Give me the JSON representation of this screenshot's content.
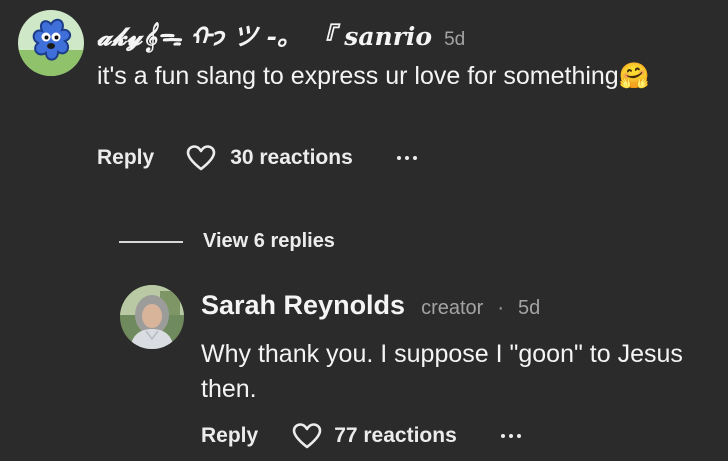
{
  "comment": {
    "username": "𝓪𝓴𝔂𝄞ᯓ ᡣ𐭩 ツ -。 『 sanrio",
    "age": "5d",
    "text": "it's a fun slang to express ur love for something",
    "emoji": "🤗",
    "reply_label": "Reply",
    "reactions": "30 reactions",
    "heart_icon": "heart-outline",
    "avatar_icon": "blue-cartoon-character"
  },
  "replies_toggle": {
    "label": "View 6 replies"
  },
  "reply": {
    "username": "Sarah Reynolds",
    "role": "creator",
    "separator": "·",
    "age": "5d",
    "text": "Why thank you. I suppose I \"goon\" to Jesus then.",
    "reply_label": "Reply",
    "reactions": "77 reactions",
    "heart_icon": "heart-outline",
    "avatar_icon": "profile-photo"
  },
  "colors": {
    "background": "#2b2b2b",
    "text": "#f4f4f4",
    "muted": "#a3a3a3"
  }
}
